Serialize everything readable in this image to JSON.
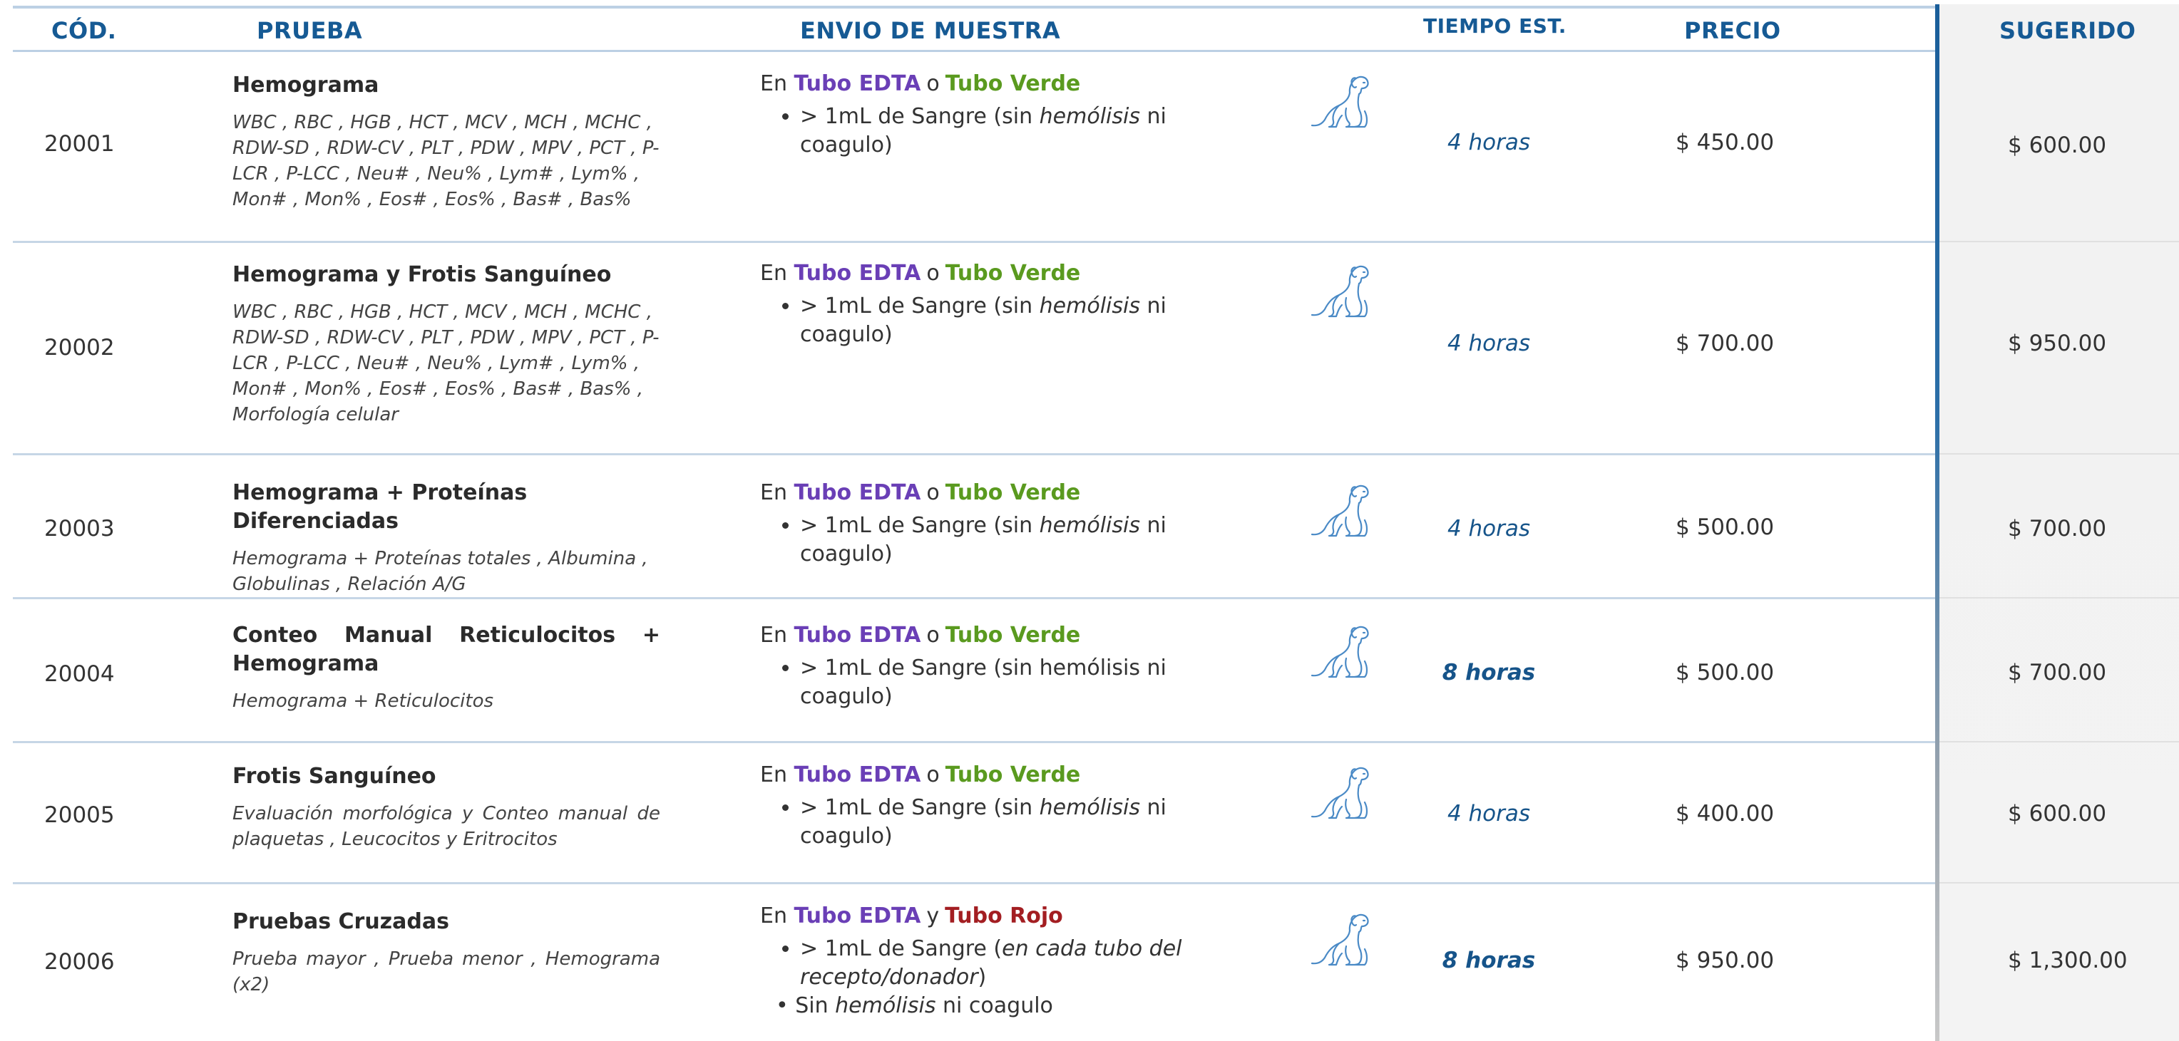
{
  "header": {
    "cod": "CÓD.",
    "prueba": "PRUEBA",
    "envio": "ENVIO DE MUESTRA",
    "tiempo": "TIEMPO EST.",
    "precio": "PRECIO",
    "sugerido": "SUGERIDO"
  },
  "colors": {
    "accent": "#165a94",
    "edta": "#6a3fb6",
    "verde": "#5a9a1f",
    "rojo": "#a31e22"
  },
  "icons": {
    "sample_animal": "dog-icon"
  },
  "rows": [
    {
      "code": "20001",
      "name": "Hemograma",
      "desc": "WBC , RBC , HGB , HCT , MCV , MCH , MCHC , RDW-SD , RDW-CV , PLT , PDW , MPV , PCT , P-LCR , P-LCC , Neu# , Neu% , Lym# , Lym% , Mon# , Mon% , Eos# , Eos% , Bas# , Bas%",
      "sample_prefix": "En",
      "tube1": "Tubo EDTA",
      "conj": "o",
      "tube2": "Tubo Verde",
      "req_a": "> 1mL de Sangre (sin ",
      "req_b": "hemólisis",
      "req_c": " ni coagulo)",
      "time": "4 horas",
      "price": "$ 450.00",
      "suggested": "$ 600.00"
    },
    {
      "code": "20002",
      "name": "Hemograma y Frotis Sanguíneo",
      "desc": "WBC , RBC , HGB , HCT , MCV , MCH , MCHC , RDW-SD , RDW-CV , PLT , PDW , MPV , PCT , P-LCR , P-LCC , Neu# , Neu% , Lym# , Lym% , Mon# , Mon% , Eos# , Eos% , Bas# , Bas% , Morfología celular",
      "sample_prefix": "En",
      "tube1": "Tubo EDTA",
      "conj": "o",
      "tube2": "Tubo Verde",
      "req_a": "> 1mL de Sangre (sin ",
      "req_b": "hemólisis",
      "req_c": " ni coagulo)",
      "time": "4 horas",
      "price": "$ 700.00",
      "suggested": "$ 950.00"
    },
    {
      "code": "20003",
      "name": "Hemograma + Proteínas Diferenciadas",
      "desc": "Hemograma + Proteínas totales , Albumina , Globulinas , Relación A/G",
      "sample_prefix": "En",
      "tube1": "Tubo EDTA",
      "conj": "o",
      "tube2": "Tubo Verde",
      "req_a": "> 1mL de Sangre (sin ",
      "req_b": "hemólisis",
      "req_c": " ni coagulo)",
      "time": "4 horas",
      "price": "$ 500.00",
      "suggested": "$ 700.00"
    },
    {
      "code": "20004",
      "name": "Conteo Manual Reticulocitos + Hemograma",
      "desc": "Hemograma + Reticulocitos",
      "sample_prefix": "En",
      "tube1": "Tubo EDTA",
      "conj": "o",
      "tube2": "Tubo Verde",
      "req_full": "> 1mL de Sangre (sin hemólisis ni coagulo)",
      "time": "8 horas",
      "price": "$ 500.00",
      "suggested": "$ 700.00"
    },
    {
      "code": "20005",
      "name": "Frotis Sanguíneo",
      "desc": "Evaluación morfológica y Conteo manual de plaquetas , Leucocitos y Eritrocitos",
      "sample_prefix": "En",
      "tube1": "Tubo EDTA",
      "conj": "o",
      "tube2": "Tubo Verde",
      "req_a": "> 1mL de Sangre (sin ",
      "req_b": "hemólisis",
      "req_c": " ni coagulo)",
      "time": "4 horas",
      "price": "$ 400.00",
      "suggested": "$ 600.00"
    },
    {
      "code": "20006",
      "name": "Pruebas Cruzadas",
      "desc": "Prueba mayor , Prueba menor , Hemograma (x2)",
      "sample_prefix": "En",
      "tube1": "Tubo EDTA",
      "conj": "y",
      "tube2": "Tubo Rojo",
      "req1_a": "> 1mL de Sangre (",
      "req1_b": "en cada tubo del recepto/donador",
      "req1_c": ")",
      "req2_a": "Sin ",
      "req2_b": "hemólisis",
      "req2_c": " ni coagulo",
      "time": "8 horas",
      "price": "$ 950.00",
      "suggested": "$ 1,300.00"
    }
  ]
}
